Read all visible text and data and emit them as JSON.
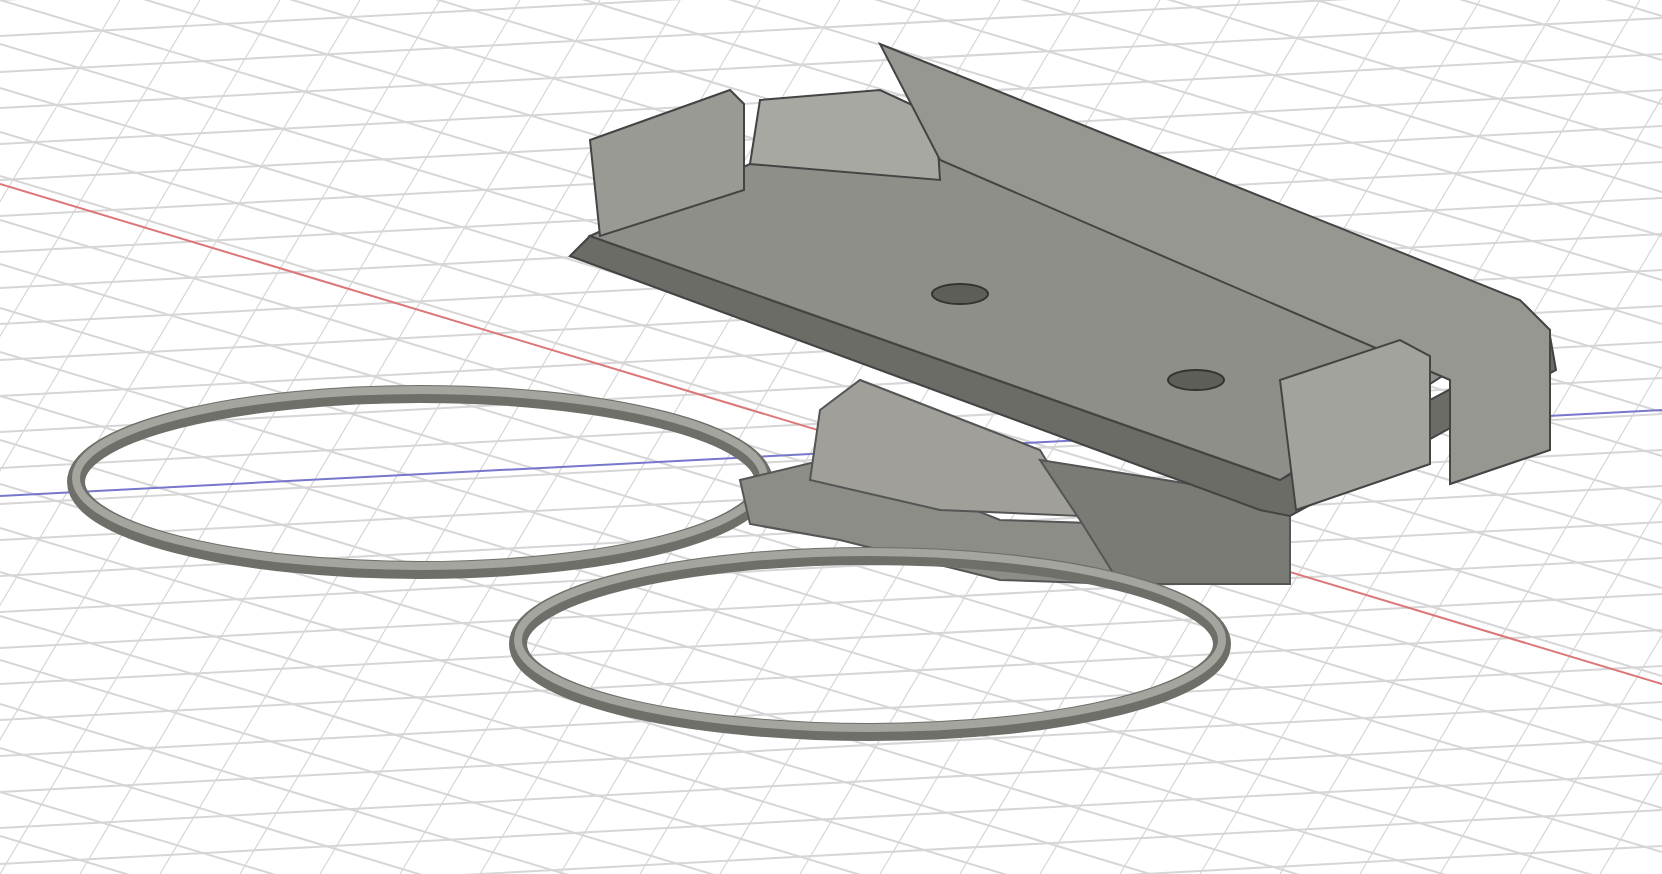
{
  "viewport": {
    "grid": true,
    "axis_lines": true
  }
}
